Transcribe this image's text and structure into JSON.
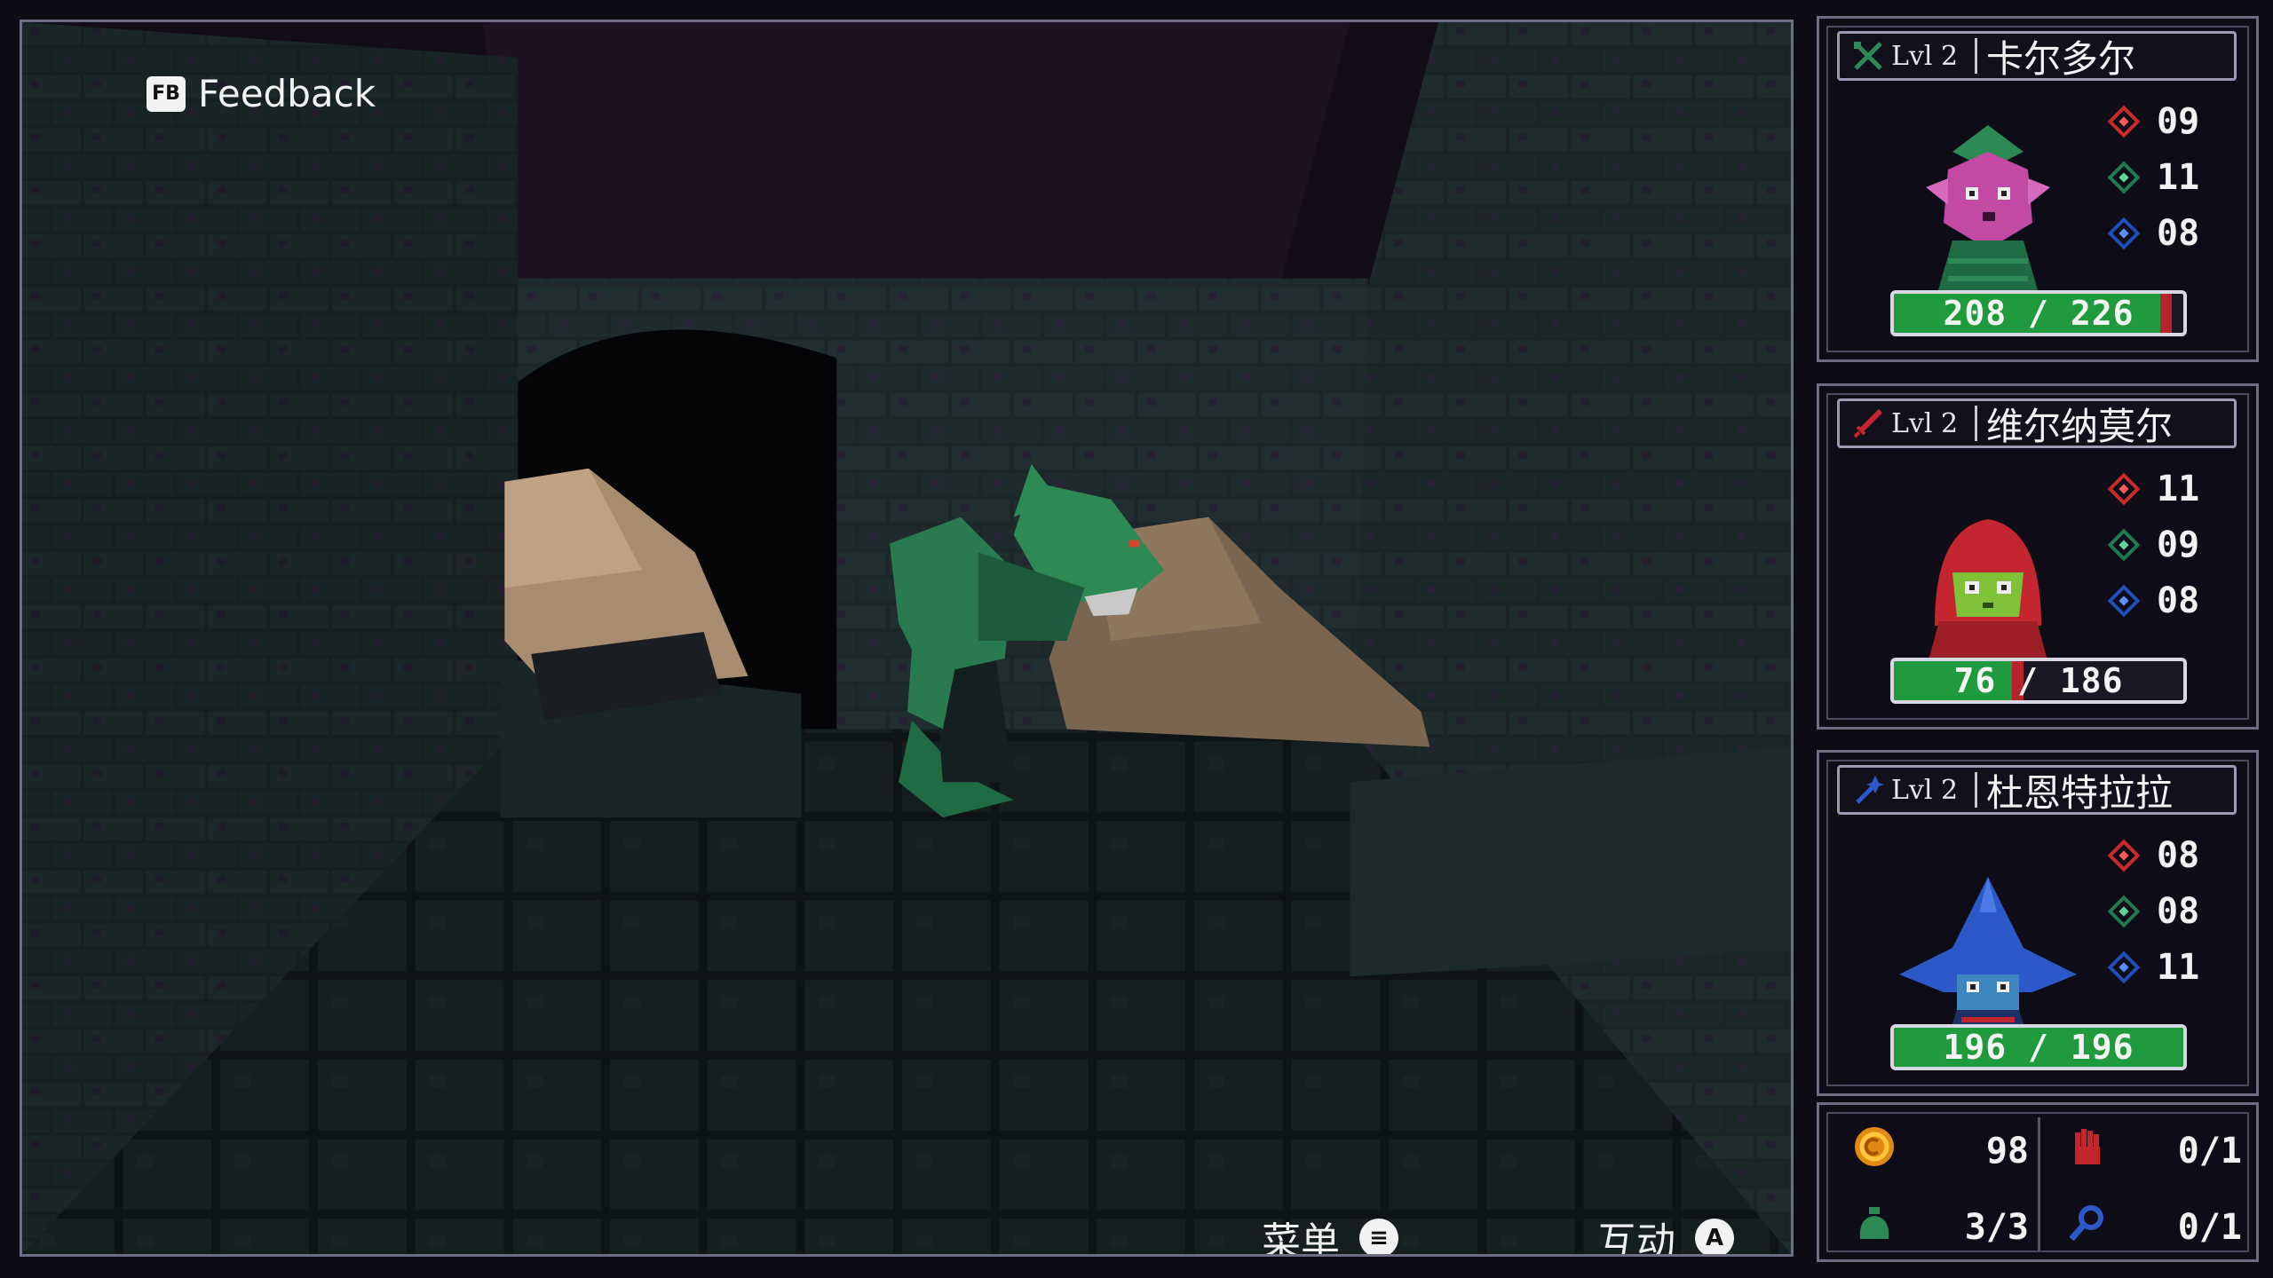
{
  "hud": {
    "feedback_icon": "FB",
    "feedback_label": "Feedback",
    "menu_label": "菜单",
    "menu_glyph": "≡",
    "interact_label": "互动",
    "interact_glyph": "A"
  },
  "party": [
    {
      "class_icon": "crossed-swords-icon",
      "level": "Lvl 2",
      "name": "卡尔多尔",
      "stats": [
        "09",
        "11",
        "08"
      ],
      "hp_text": "208 / 226",
      "hp_current": 208,
      "hp_max": 226,
      "accent": "#2e8a55"
    },
    {
      "class_icon": "dagger-icon",
      "level": "Lvl 2",
      "name": "维尔纳莫尔",
      "stats": [
        "11",
        "09",
        "08"
      ],
      "hp_text": "76 / 186",
      "hp_current": 76,
      "hp_max": 186,
      "accent": "#c3262e"
    },
    {
      "class_icon": "wand-icon",
      "level": "Lvl 2",
      "name": "杜恩特拉拉",
      "stats": [
        "08",
        "08",
        "11"
      ],
      "hp_text": "196 / 196",
      "hp_current": 196,
      "hp_max": 196,
      "accent": "#2c58c9"
    }
  ],
  "resources": {
    "gold": "98",
    "potions": "3/3",
    "hands": "0/1",
    "keys": "0/1"
  },
  "colors": {
    "hp_fill": "#1f9a3c",
    "hp_lost": "#b8232b",
    "frame": "#6e6d86"
  }
}
